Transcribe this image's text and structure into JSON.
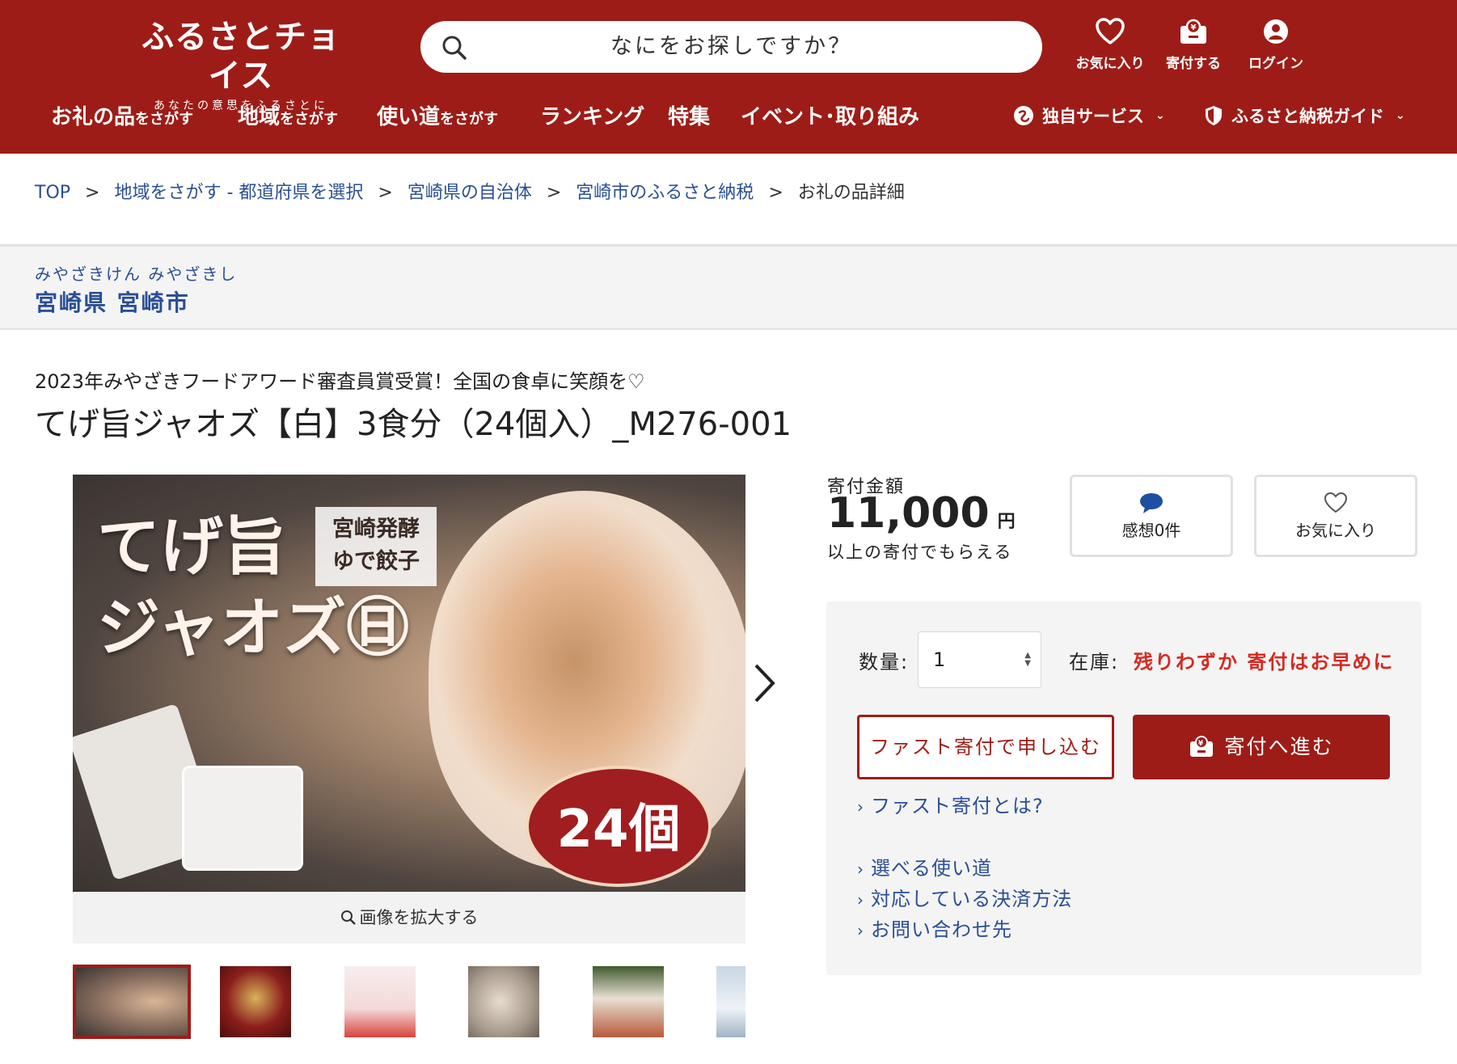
{
  "header": {
    "logo_main": "ふるさとチョイス",
    "logo_sub": "あなたの意思をふるさとに",
    "search_placeholder": "なにをお探しですか？",
    "actions": {
      "favorites": "お気に入り",
      "donate": "寄付する",
      "login": "ログイン"
    }
  },
  "nav": {
    "gifts_big": "お礼の品",
    "gifts_small": "をさがす",
    "region_big": "地域",
    "region_small": "をさがす",
    "usage_big": "使い道",
    "usage_small": "をさがす",
    "ranking": "ランキング",
    "feature": "特集",
    "events": "イベント･取り組み",
    "services": "独自サービス",
    "guide": "ふるさと納税ガイド"
  },
  "breadcrumb": {
    "top": "TOP",
    "region": "地域をさがす - 都道府県を選択",
    "prefecture": "宮崎県の自治体",
    "city": "宮崎市のふるさと納税",
    "current": "お礼の品詳細",
    "separator": ">"
  },
  "municipality": {
    "kana": "みやざきけん みやざきし",
    "name": "宮崎県 宮崎市"
  },
  "product": {
    "catch": "2023年みやざきフードアワード審査員賞受賞！全国の食卓に笑顔を♡",
    "title": "てげ旨ジャオズ【白】3食分（24個入）_M276-001",
    "image_title_line1": "てげ旨",
    "image_title_line2": "ジャオズ㊐",
    "image_tag_line1": "宮崎発酵",
    "image_tag_line2": "ゆで餃子",
    "image_badge": "24個",
    "zoom_label": "画像を拡大する"
  },
  "donation": {
    "amount_label": "寄付金額",
    "amount": "11,000",
    "currency": "円",
    "amount_note": "以上の寄付でもらえる",
    "reviews_label": "感想0件",
    "favorite_label": "お気に入り",
    "qty_label": "数量:",
    "qty_value": "1",
    "stock_label": "在庫:",
    "stock_value": "残りわずか 寄付はお早めに",
    "fast_button": "ファスト寄付で申し込む",
    "donate_button": "寄付へ進む",
    "links": {
      "fast_about": "ファスト寄付とは?",
      "usage": "選べる使い道",
      "payment": "対応している決済方法",
      "contact": "お問い合わせ先"
    }
  },
  "colors": {
    "brand": "#9e1c17",
    "link": "#2a4f94",
    "alert": "#d42a21",
    "panel_bg": "#f4f4f4"
  }
}
